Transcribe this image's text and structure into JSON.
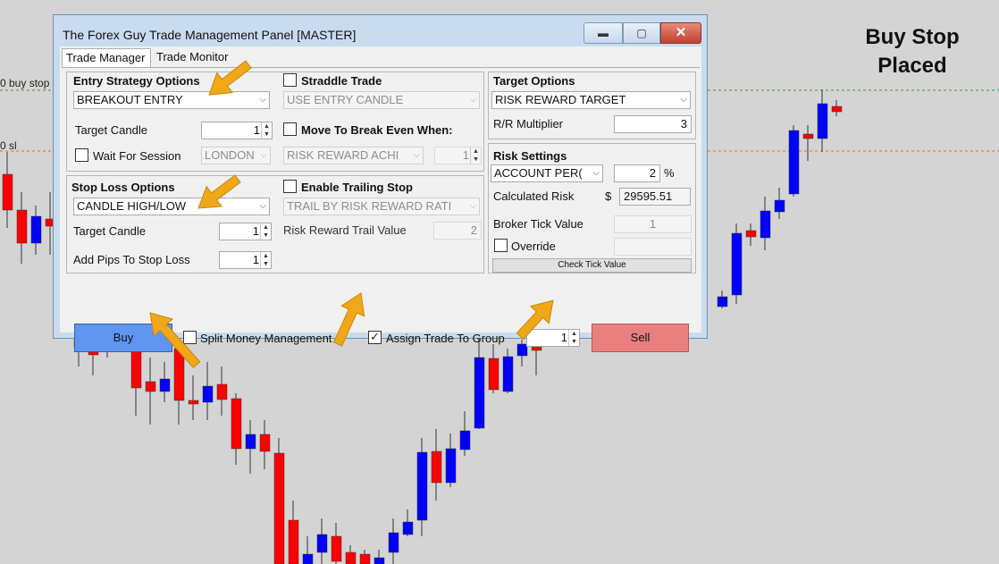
{
  "chart": {
    "line_labels": {
      "buy_stop": "0 buy stop",
      "sl": "0 sl"
    },
    "caption": {
      "line1": "Buy Stop",
      "line2": "Placed"
    },
    "colors": {
      "bull": "#0000ff",
      "bear": "#ff0000",
      "buy_stop_line": "#2e9e44",
      "sl_line": "#e07020",
      "background": "#d4d4d4",
      "arrow": "#f0a818"
    }
  },
  "window": {
    "title": "The Forex Guy Trade Management Panel [MASTER]",
    "controls": {
      "minimize": "▬",
      "maximize": "▢",
      "close": "✕"
    },
    "tabs": [
      {
        "label": "Trade Manager"
      },
      {
        "label": "Trade Monitor"
      }
    ]
  },
  "entry": {
    "header": "Entry Strategy Options",
    "strategy_value": "BREAKOUT ENTRY",
    "target_candle_label": "Target Candle",
    "target_candle_value": "1",
    "wait_session_label": "Wait For Session",
    "session_value": "LONDON"
  },
  "straddle": {
    "header": "Straddle Trade",
    "candle_value": "USE ENTRY CANDLE",
    "breakeven_label": "Move To Break Even When:",
    "breakeven_value": "RISK REWARD ACHI",
    "breakeven_num": "1"
  },
  "stoploss": {
    "header": "Stop Loss Options",
    "method_value": "CANDLE HIGH/LOW",
    "target_candle_label": "Target Candle",
    "target_candle_value": "1",
    "add_pips_label": "Add Pips To Stop Loss",
    "add_pips_value": "1"
  },
  "trailing": {
    "header": "Enable Trailing Stop",
    "method_value": "TRAIL BY RISK REWARD RATI",
    "value_label": "Risk Reward Trail Value",
    "value": "2"
  },
  "target": {
    "header": "Target Options",
    "method_value": "RISK REWARD TARGET",
    "multiplier_label": "R/R Multiplier",
    "multiplier_value": "3"
  },
  "risk": {
    "header": "Risk Settings",
    "mode_value": "ACCOUNT PER(",
    "percent_value": "2",
    "percent_sign": "%",
    "calc_label": "Calculated Risk",
    "currency": "$",
    "calc_value": "29595.51",
    "tick_label": "Broker Tick Value",
    "tick_value": "1",
    "override_label": "Override",
    "check_tick_button": "Check Tick Value"
  },
  "actions": {
    "buy": "Buy",
    "split_label": "Split Money Management",
    "assign_label": "Assign Trade To Group",
    "assign_checked": "✓",
    "group_value": "1",
    "sell": "Sell"
  },
  "spin_arrows": {
    "up": "▲",
    "down": "▼"
  },
  "dropdown_arrow": "⌵"
}
